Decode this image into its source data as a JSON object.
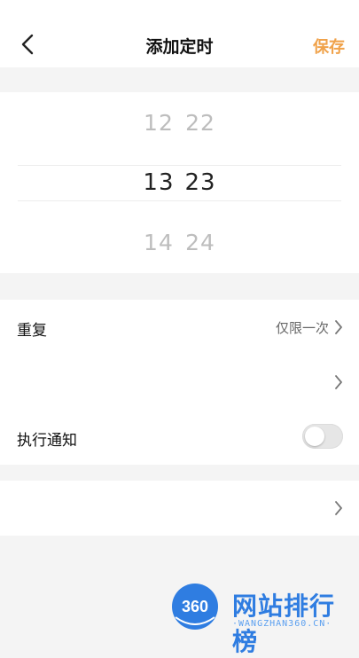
{
  "header": {
    "title": "添加定时",
    "save_label": "保存"
  },
  "picker": {
    "rows": [
      {
        "hour": "12",
        "minute": "22"
      },
      {
        "hour": "13",
        "minute": "23"
      },
      {
        "hour": "14",
        "minute": "24"
      }
    ],
    "selected_index": 1
  },
  "settings": {
    "repeat": {
      "label": "重复",
      "value": "仅限一次"
    },
    "blank_row": {
      "label": ""
    },
    "notify": {
      "label": "执行通知",
      "enabled": false
    }
  },
  "extra_row": {
    "label": ""
  },
  "watermark": {
    "badge": "360",
    "name": "网站排行榜",
    "url": "·WANGZHAN360.CN·"
  },
  "colors": {
    "accent": "#f0a24a",
    "toggle_off": "#e6e6e6",
    "watermark": "#2f7de1"
  }
}
